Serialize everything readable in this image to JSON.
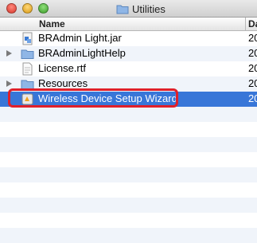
{
  "window": {
    "title": "Utilities"
  },
  "columns": {
    "name": "Name",
    "date": "Da"
  },
  "files": [
    {
      "name": "BRAdmin Light.jar",
      "date": "20",
      "icon": "jar-icon",
      "expandable": false,
      "selected": false
    },
    {
      "name": "BRAdminLightHelp",
      "date": "20",
      "icon": "folder-icon",
      "expandable": true,
      "selected": false
    },
    {
      "name": "License.rtf",
      "date": "20",
      "icon": "document-icon",
      "expandable": false,
      "selected": false
    },
    {
      "name": "Resources",
      "date": "20",
      "icon": "folder-icon",
      "expandable": true,
      "selected": false
    },
    {
      "name": "Wireless Device Setup Wizard",
      "date": "20",
      "icon": "app-icon",
      "expandable": false,
      "selected": true
    }
  ],
  "colors": {
    "selection": "#3876d8",
    "highlight_box": "#e0202a",
    "alt_row": "#f0f4fa"
  }
}
